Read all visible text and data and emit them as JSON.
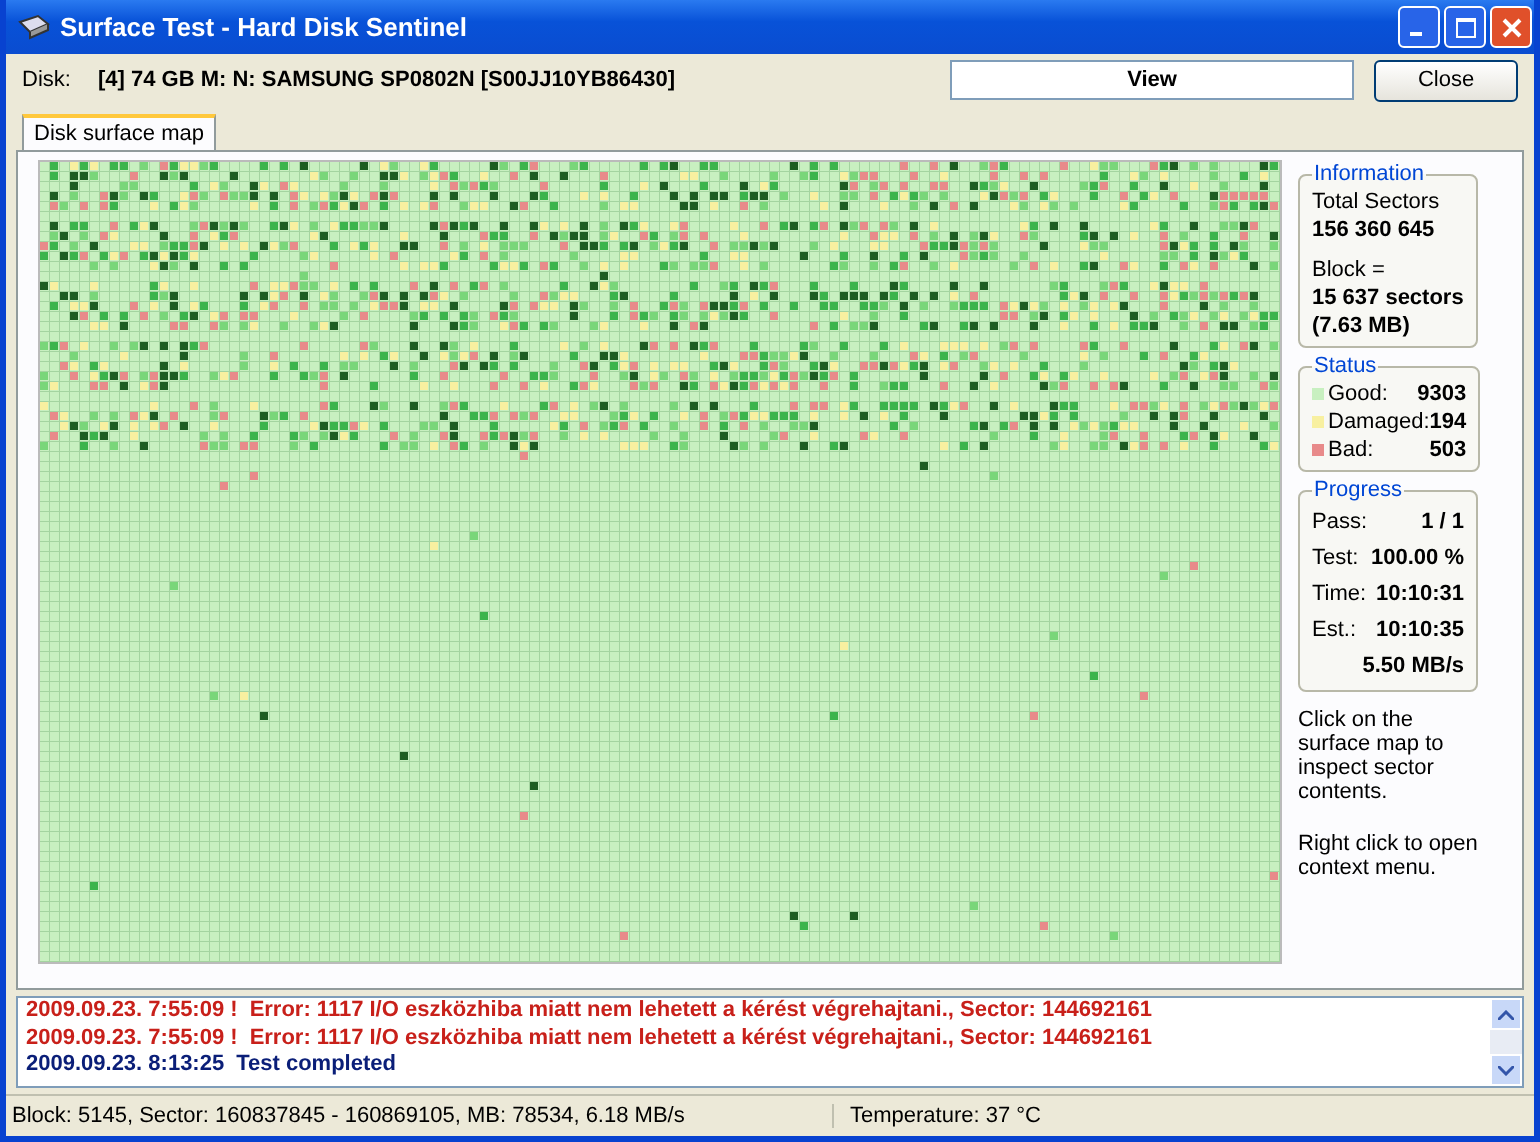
{
  "window": {
    "title": "Surface Test - Hard Disk Sentinel"
  },
  "disk": {
    "label": "Disk:",
    "value": "[4] 74 GB M: N: SAMSUNG SP0802N [S00JJ10YB86430]"
  },
  "buttons": [
    {
      "kind": "view",
      "label": "View"
    },
    {
      "kind": "close",
      "label": "Close"
    }
  ],
  "tabs": [
    {
      "label": "Disk surface map",
      "selected": true
    }
  ],
  "information": {
    "title": "Information",
    "total_label": "Total Sectors",
    "total_value": "156 360 645",
    "block_label": "Block =",
    "block_sectors": "15 637 sectors",
    "block_size": "(7.63 MB)"
  },
  "status": {
    "title": "Status",
    "items": [
      {
        "label": "Good:",
        "value": "9303",
        "color": "#c8f0c0"
      },
      {
        "label": "Damaged:",
        "value": "194",
        "color": "#f8f0a0"
      },
      {
        "label": "Bad:",
        "value": "503",
        "color": "#e88a8a"
      }
    ]
  },
  "progress": {
    "title": "Progress",
    "rows": [
      {
        "label": "Pass:",
        "value": "1 / 1"
      },
      {
        "label": "Test:",
        "value": "100.00 %"
      },
      {
        "label": "Time:",
        "value": "10:10:31"
      },
      {
        "label": "Est.:",
        "value": "10:10:35"
      }
    ],
    "speed": "5.50 MB/s"
  },
  "hints": [
    "Click on the surface map to inspect sector contents.",
    "Right click to open context menu."
  ],
  "log": [
    {
      "kind": "error",
      "time": "2009.09.23. 7:55:09 !",
      "message": "Error: 1117 I/O eszközhiba miatt nem lehetett a kérést végrehajtani., Sector: 144692161"
    },
    {
      "kind": "error",
      "time": "2009.09.23. 7:55:09 !",
      "message": "Error: 1117 I/O eszközhiba miatt nem lehetett a kérést végrehajtani., Sector: 144692161"
    },
    {
      "kind": "info",
      "time": "2009.09.23. 8:13:25",
      "message": "Test completed"
    }
  ],
  "status_bar": {
    "left": "Block: 5145, Sector: 160837845 - 160869105, MB: 78534, 6.18 MB/s",
    "right": "Temperature: 37  °C"
  }
}
